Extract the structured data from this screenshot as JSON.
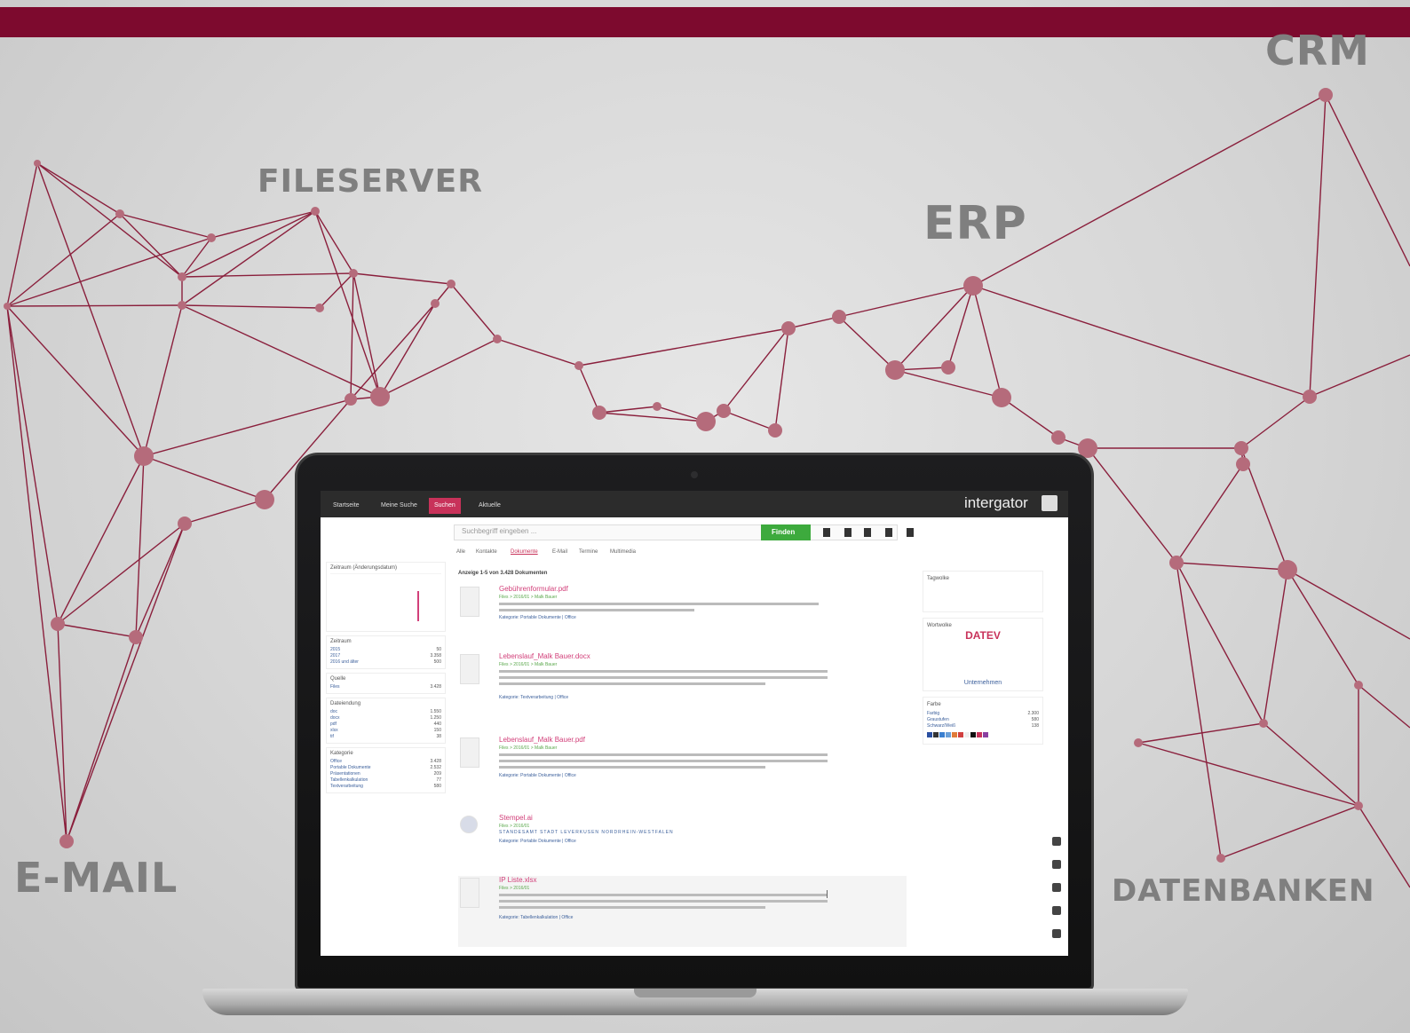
{
  "labels": {
    "fileserver": "FILESERVER",
    "erp": "ERP",
    "crm": "CRM",
    "email": "E-MAIL",
    "datenbanken": "DATENBANKEN"
  },
  "colors": {
    "brand": "#7d0a2e",
    "network_line": "#8a1f3c",
    "node": "#b56b7b",
    "accent": "#c8325a",
    "find_button": "#3daa3d"
  },
  "app": {
    "brand": "intergator",
    "nav": [
      "Startseite",
      "Meine Suche",
      "Suchen",
      "Aktuelle"
    ],
    "search_placeholder": "Suchbegriff eingeben ...",
    "find_button": "Finden",
    "filter_tabs": [
      "Alle",
      "Kontakte",
      "Dokumente",
      "E-Mail",
      "Termine",
      "Multimedia"
    ],
    "results_header": "Anzeige 1-5 von 3.428 Dokumenten",
    "sidebar": {
      "chart_title": "Zeitraum (Änderungsdatum)",
      "panel_zeitraum": "Zeitraum",
      "zeitraum_rows": [
        [
          "2015",
          "50"
        ],
        [
          "2017",
          "3.358"
        ],
        [
          "2016 und älter",
          "500"
        ]
      ],
      "panel_quelle": "Quelle",
      "quelle_rows": [
        [
          "Files",
          "3.428"
        ]
      ],
      "panel_dateien": "Dateiendung",
      "dateien_rows": [
        [
          "doc",
          "1.550"
        ],
        [
          "docx",
          "1.250"
        ],
        [
          "pdf",
          "440"
        ],
        [
          "xlsx",
          "150"
        ],
        [
          "tif",
          "38"
        ]
      ],
      "panel_kategorie": "Kategorie",
      "kategorie_rows": [
        [
          "Office",
          "3.428"
        ],
        [
          "Portable Dokumente",
          "2.532"
        ],
        [
          "Präsentationen",
          "209"
        ],
        [
          "Tabellenkalkulation",
          "77"
        ],
        [
          "Textverarbeitung",
          "580"
        ]
      ]
    },
    "results": [
      {
        "title": "Gebührenformular.pdf",
        "path": "Files > 2016/01 > Malk Bauer",
        "meta": "Kategorie: Portable Dokumente | Office"
      },
      {
        "title": "Lebenslauf_Malk Bauer.docx",
        "path": "Files > 2016/01 > Malk Bauer",
        "meta": "Kategorie: Textverarbeitung | Office"
      },
      {
        "title": "Lebenslauf_Malk Bauer.pdf",
        "path": "Files > 2016/01 > Malk Bauer",
        "meta": "Kategorie: Portable Dokumente | Office"
      },
      {
        "title": "Stempel.ai",
        "path": "Files > 2016/01",
        "meta": "Kategorie: Portable Dokumente | Office"
      },
      {
        "title": "IP Liste.xlsx",
        "path": "Files > 2016/01",
        "meta": "Kategorie: Tabellenkalkulation | Office"
      }
    ],
    "stamp_text": "STANDESAMT STADT LEVERKUSEN NORDRHEIN-WESTFALEN",
    "right": {
      "tags_title": "Tagwolke",
      "cloud_title": "Wortwolke",
      "cloud_big": "DATEV",
      "cloud_mid": "Unternehmen",
      "farbe_title": "Farbe",
      "farbe_rows": [
        [
          "Farbig",
          "2.300"
        ],
        [
          "Graustufen",
          "580"
        ],
        [
          "Schwarz/Weiß",
          "138"
        ]
      ]
    }
  }
}
